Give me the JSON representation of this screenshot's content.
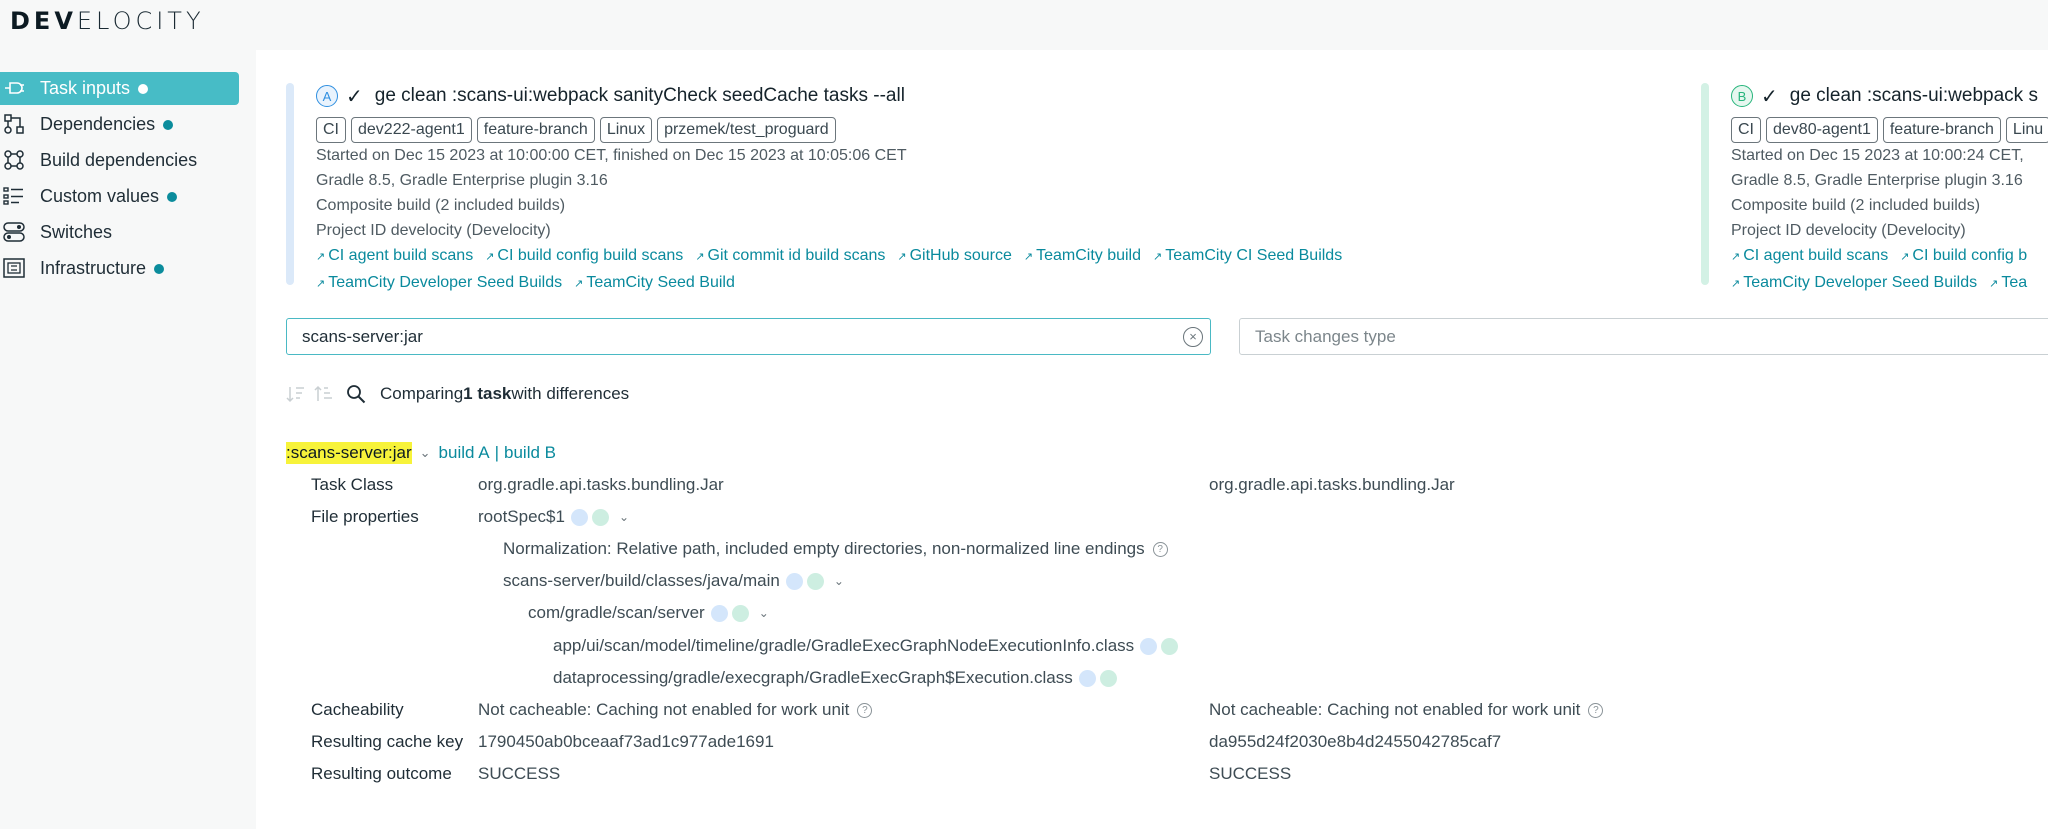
{
  "app": {
    "logo_bold": "DEV",
    "logo_rest": "ELOCITY"
  },
  "sidebar": {
    "items": [
      {
        "label": "Task inputs",
        "icon": "plug-icon",
        "active": true,
        "dot": true
      },
      {
        "label": "Dependencies",
        "icon": "dependency-graph-icon",
        "active": false,
        "dot": true
      },
      {
        "label": "Build dependencies",
        "icon": "build-dependency-icon",
        "active": false,
        "dot": false
      },
      {
        "label": "Custom values",
        "icon": "list-icon",
        "active": false,
        "dot": true
      },
      {
        "label": "Switches",
        "icon": "toggle-switch-icon",
        "active": false,
        "dot": false
      },
      {
        "label": "Infrastructure",
        "icon": "chip-icon",
        "active": false,
        "dot": true
      }
    ]
  },
  "build_a": {
    "badge": "A",
    "command": "ge  clean :scans-ui:webpack sanityCheck seedCache tasks --all",
    "tags": [
      "CI",
      "dev222-agent1",
      "feature-branch",
      "Linux",
      "przemek/test_proguard"
    ],
    "started": "Started on Dec 15 2023 at 10:00:00 CET, finished on Dec 15 2023 at 10:05:06 CET",
    "gradle": "Gradle 8.5,  Gradle Enterprise plugin 3.16",
    "composite": "Composite build (2 included builds)",
    "project": "Project ID develocity (Develocity)",
    "links_row1": [
      "CI agent build scans",
      "CI build config build scans",
      "Git commit id build scans",
      "GitHub source",
      "TeamCity build",
      "TeamCity CI Seed Builds"
    ],
    "links_row2": [
      "TeamCity Developer Seed Builds",
      "TeamCity Seed Build"
    ]
  },
  "build_b": {
    "badge": "B",
    "command": "ge  clean :scans-ui:webpack s",
    "tags": [
      "CI",
      "dev80-agent1",
      "feature-branch",
      "Linu"
    ],
    "started": "Started on Dec 15 2023 at 10:00:24 CET,",
    "gradle": "Gradle 8.5,  Gradle Enterprise plugin 3.16",
    "composite": "Composite build (2 included builds)",
    "project": "Project ID develocity (Develocity)",
    "links_row1": [
      "CI agent build scans",
      "CI build config b"
    ],
    "links_row2": [
      "TeamCity Developer Seed Builds",
      "Tea"
    ]
  },
  "search": {
    "value": "scans-server:jar",
    "clear_glyph": "×"
  },
  "filter": {
    "placeholder": "Task changes type"
  },
  "comparing": {
    "prefix": "Comparing ",
    "count": "1 task",
    "suffix": " with differences"
  },
  "task": {
    "name": ":scans-server:jar",
    "link_a": "build A",
    "link_sep": "|",
    "link_b": "build B",
    "rows": {
      "task_class_label": "Task Class",
      "task_class_a": "org.gradle.api.tasks.bundling.Jar",
      "task_class_b": "org.gradle.api.tasks.bundling.Jar",
      "file_props_label": "File properties",
      "root_spec": "rootSpec$1",
      "normalization": "Normalization: Relative path, included empty directories, non-normalized line endings",
      "path1": "scans-server/build/classes/java/main",
      "path2": "com/gradle/scan/server",
      "path3": "app/ui/scan/model/timeline/gradle/GradleExecGraphNodeExecutionInfo.class",
      "path4": "dataprocessing/gradle/execgraph/GradleExecGraph$Execution.class",
      "cacheability_label": "Cacheability",
      "cacheability_a": "Not cacheable: Caching not enabled for work unit",
      "cacheability_b": "Not cacheable: Caching not enabled for work unit",
      "cache_key_label": "Resulting cache key",
      "cache_key_a": "1790450ab0bceaaf73ad1c977ade1691",
      "cache_key_b": "da955d24f2030e8b4d2455042785caf7",
      "outcome_label": "Resulting outcome",
      "outcome_a": "SUCCESS",
      "outcome_b": "SUCCESS"
    }
  },
  "colors": {
    "accent": "#47bcc6",
    "link": "#0a8a9d",
    "dot": "#0b8c9c",
    "build_a": "#2f8fe0",
    "build_b": "#27b57c",
    "highlight": "#f7f33a"
  }
}
